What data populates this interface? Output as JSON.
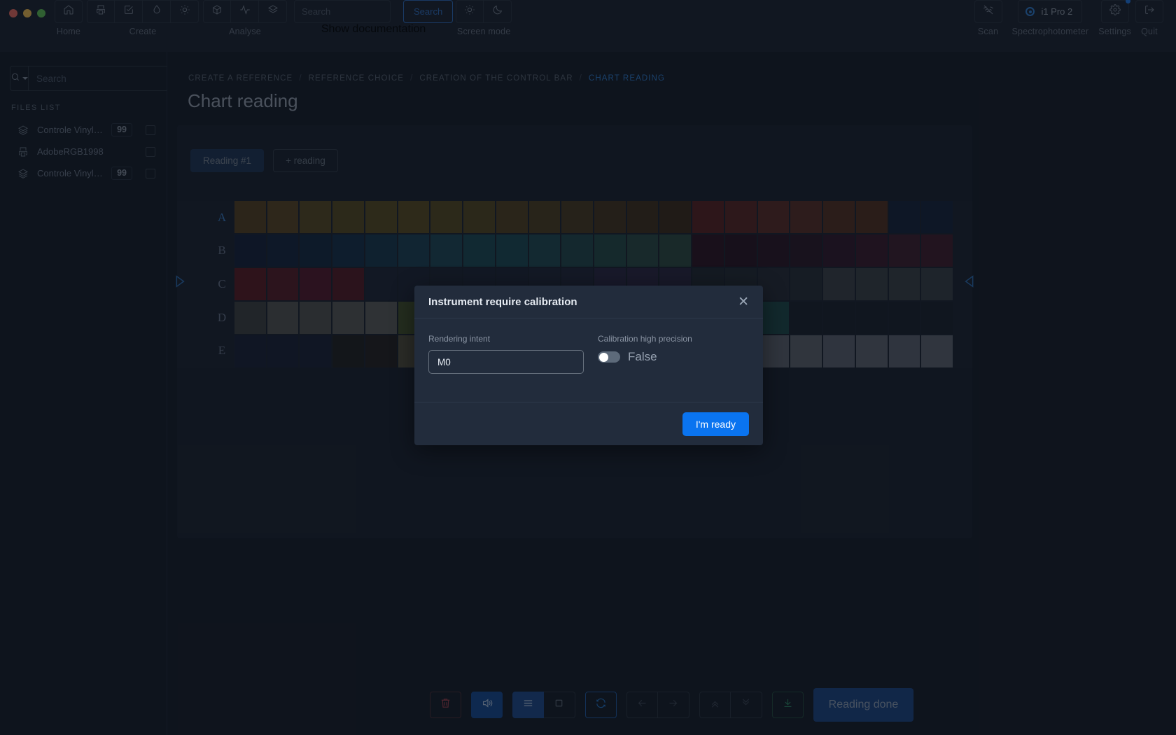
{
  "window": {
    "controls": [
      "close",
      "minimize",
      "maximize"
    ]
  },
  "toolbar": {
    "groups": [
      {
        "label": "Home",
        "buttons": [
          {
            "icon": "home-icon"
          }
        ]
      },
      {
        "label": "Create",
        "buttons": [
          {
            "icon": "printer-icon"
          },
          {
            "icon": "check-square-icon"
          },
          {
            "icon": "droplet-icon"
          },
          {
            "icon": "sun-icon"
          }
        ]
      },
      {
        "label": "Analyse",
        "buttons": [
          {
            "icon": "box-icon"
          },
          {
            "icon": "activity-icon"
          },
          {
            "icon": "layers-icon"
          }
        ]
      }
    ],
    "search": {
      "placeholder": "Search",
      "value": "",
      "button_label": "Search",
      "caption": "Show documentation"
    },
    "screen_mode": {
      "caption": "Screen mode",
      "buttons": [
        {
          "icon": "sun-icon"
        },
        {
          "icon": "moon-icon"
        }
      ]
    },
    "scan": {
      "caption": "Scan",
      "icon": "scan-off-icon"
    },
    "spectrophotometer": {
      "caption": "Spectrophotometer",
      "device": "i1 Pro 2",
      "icon": "radio-dot-icon"
    },
    "settings": {
      "caption": "Settings",
      "icon": "gear-icon",
      "has_badge": true
    },
    "quit": {
      "caption": "Quit",
      "icon": "logout-icon"
    }
  },
  "sidebar": {
    "search": {
      "placeholder": "Search",
      "value": "",
      "icon": "search-icon"
    },
    "files_title": "FILES LIST",
    "files": [
      {
        "icon": "layers-icon",
        "name": "Controle Vinyl Avery - ...",
        "badge": "99",
        "checked": false
      },
      {
        "icon": "printer-icon",
        "name": "AdobeRGB1998",
        "badge": "",
        "checked": false
      },
      {
        "icon": "layers-icon",
        "name": "Controle Vinyl Avery - ...",
        "badge": "99",
        "checked": false
      }
    ]
  },
  "breadcrumb": [
    {
      "label": "CREATE A REFERENCE",
      "active": false
    },
    {
      "label": "REFERENCE CHOICE",
      "active": false
    },
    {
      "label": "CREATION OF THE CONTROL BAR",
      "active": false
    },
    {
      "label": "CHART READING",
      "active": true
    }
  ],
  "page": {
    "title": "Chart reading"
  },
  "card": {
    "tabs": [
      {
        "label": "Reading #1",
        "selected": true
      },
      {
        "label": "+ reading",
        "selected": false
      }
    ],
    "nav": {
      "left_icon": "triangle-left-icon",
      "right_icon": "triangle-right-icon"
    }
  },
  "chart_data": {
    "type": "heatmap",
    "title": "Chart reading patch grid",
    "row_labels": [
      "A",
      "B",
      "C",
      "D",
      "E"
    ],
    "selected_row": "A",
    "columns": 22,
    "rows": [
      [
        "#584020",
        "#5b4522",
        "#594a23",
        "#574a20",
        "#5a4d21",
        "#5b4c20",
        "#574a1f",
        "#554720",
        "#534221",
        "#4e3e20",
        "#4b3a1f",
        "#46341d",
        "#41301c",
        "#3c2b1a",
        "#5a1f20",
        "#5a2422",
        "#5b2a24",
        "#592e24",
        "#56301f",
        "#532f1d",
        "#16233a",
        "#16233a"
      ],
      [
        "#16203a",
        "#14243f",
        "#132941",
        "#14304a",
        "#17394f",
        "#1b4156",
        "#1d4858",
        "#1b4a56",
        "#1b4956",
        "#1f4a53",
        "#22484c",
        "#254a48",
        "#2b4b45",
        "#2e4b42",
        "#2d1322",
        "#291323",
        "#2a1624",
        "#2a1726",
        "#31172a",
        "#3a1a2b",
        "#3f1d2d",
        "#411c2b"
      ],
      [
        "#5c1a23",
        "#571b27",
        "#56182a",
        "#561a25",
        "#1e2535",
        "#1d2436",
        "#1d2434",
        "#1e2535",
        "#1e2535",
        "#1f2638",
        "#22273b",
        "#2b2743",
        "#2e2743",
        "#2a2640",
        "#222832",
        "#252b34",
        "#262c35",
        "#272d36",
        "#3c4248",
        "#3a4046",
        "#3a4046",
        "#393f45"
      ],
      [
        "#3f4140",
        "#545453",
        "#535351",
        "#5a5a58",
        "#5e5e5c",
        "#46532c",
        "#3b5331",
        "#3a5234",
        "#2c4525",
        "#223f29",
        "#113c2f",
        "#0f3b31",
        "#1c3e2f",
        "#1f402e",
        "#14323b",
        "#143a43",
        "#1e4a4b",
        "#191f2a",
        "#191f2a",
        "#191f2a",
        "#191f2a",
        "#191f2a"
      ],
      [
        "#1a2036",
        "#1a2036",
        "#1a2036",
        "#211f1f",
        "#242120",
        "#56503f",
        "#565049",
        "#5b564d",
        "#3f2b23",
        "#3f3f2c",
        "#3e3f3f",
        "#454646",
        "#28292f",
        "#5a2c1a",
        "#172535",
        "#5f646f",
        "#60656f",
        "#5f646e",
        "#5e6370",
        "#5f646f",
        "#5e6370",
        "#5f6470"
      ]
    ]
  },
  "modal": {
    "title": "Instrument require calibration",
    "close_icon": "close-icon",
    "rendering_intent": {
      "label": "Rendering intent",
      "value": "M0"
    },
    "high_precision": {
      "label": "Calibration high precision",
      "value": "False",
      "on": false
    },
    "confirm_label": "I'm ready"
  },
  "bottombar": {
    "buttons": [
      {
        "icon": "trash-icon",
        "style": "danger"
      },
      {
        "icon": "volume-icon",
        "style": "primary"
      },
      {
        "icon": "menu-icon",
        "style": "filled-accent"
      },
      {
        "icon": "square-icon",
        "style": "neutral"
      },
      {
        "icon": "refresh-icon",
        "style": "outline-accent"
      },
      {
        "icon": "arrow-left-icon",
        "style": "dim"
      },
      {
        "icon": "arrow-right-icon",
        "style": "dim"
      },
      {
        "icon": "chevrons-up-icon",
        "style": "dim"
      },
      {
        "icon": "chevrons-down-icon",
        "style": "dim"
      },
      {
        "icon": "download-icon",
        "style": "success"
      }
    ],
    "done_label": "Reading done"
  },
  "colors": {
    "accent": "#0a74f0",
    "accent_dark": "#1b4586",
    "background": "#161c27",
    "panel": "#1a212d",
    "modal": "#222c3c",
    "danger": "#a13f4c",
    "success": "#2e8a65",
    "text_muted": "#6e788a"
  }
}
